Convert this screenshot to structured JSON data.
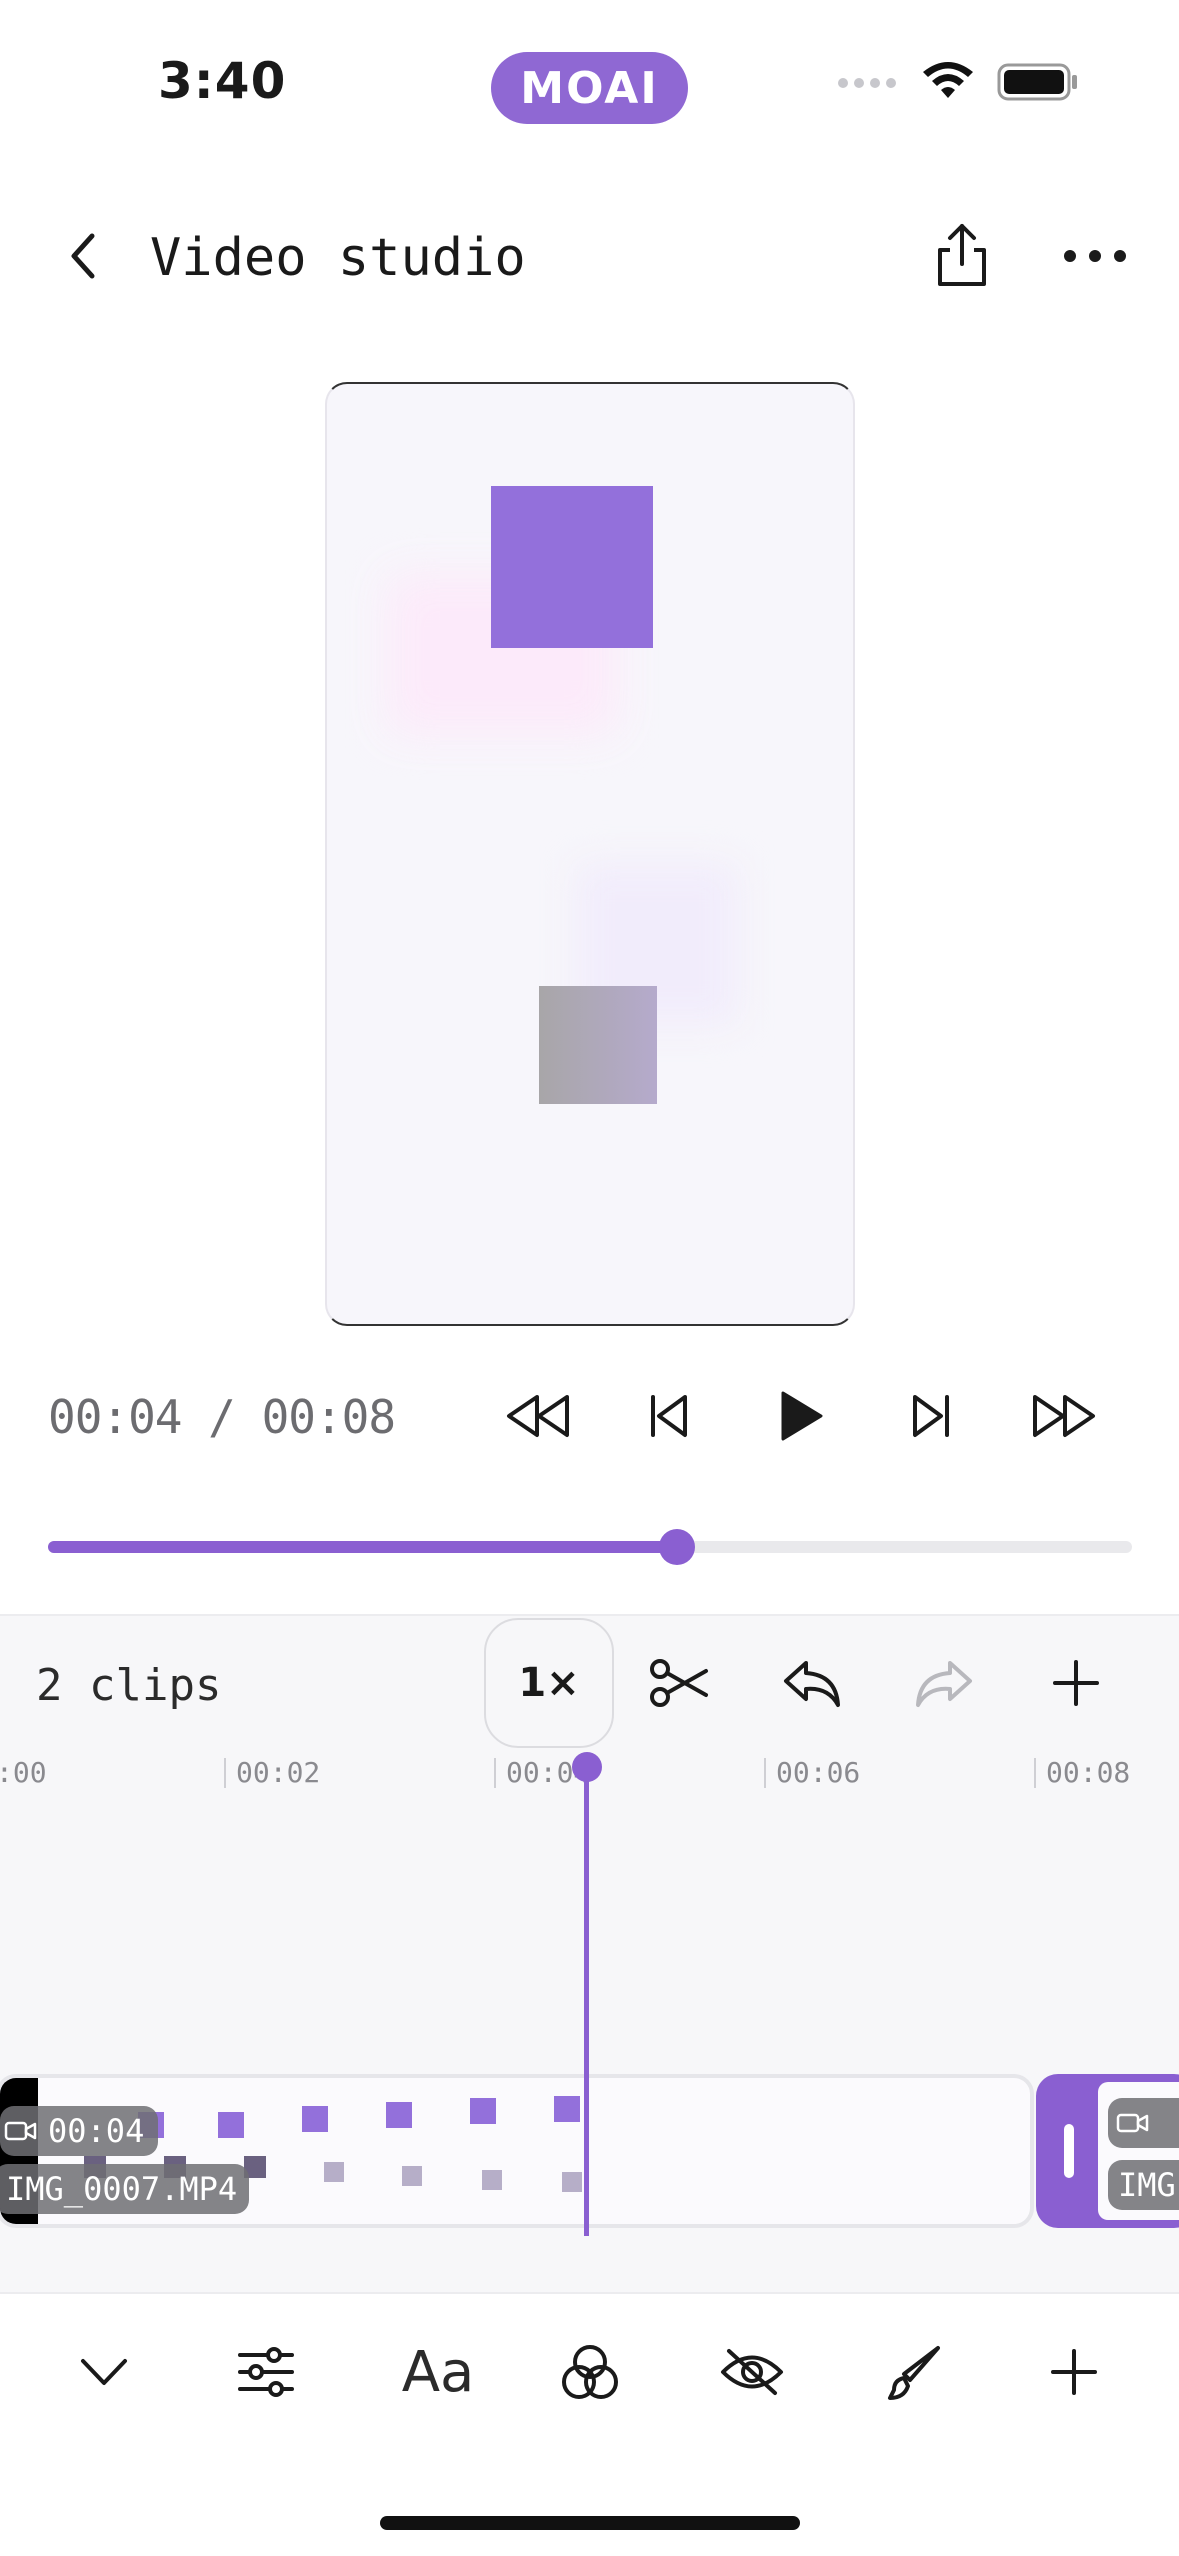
{
  "status_bar": {
    "time": "3:40",
    "app_pill": "MOAI"
  },
  "header": {
    "title": "Video studio",
    "icons": [
      "chevron-left-icon",
      "share-icon",
      "more-horizontal-icon"
    ]
  },
  "player": {
    "current_time": "00:04",
    "separator": " / ",
    "duration": "00:08",
    "progress": 0.58,
    "controls": [
      "rewind-icon",
      "skip-back-icon",
      "play-icon",
      "skip-forward-icon",
      "fast-forward-icon"
    ]
  },
  "timeline": {
    "clips_label": "2 clips",
    "speed_label": "1×",
    "tools": [
      "scissors-icon",
      "undo-icon",
      "redo-icon",
      "plus-icon"
    ],
    "ruler": [
      ":00",
      "00:02",
      "00:04",
      "00:06",
      "00:08"
    ],
    "clip1": {
      "duration": "00:04",
      "name": "IMG_0007.MP4"
    },
    "clip2": {
      "name": "IMG"
    }
  },
  "bottom_toolbar": {
    "items": [
      "chevron-down-icon",
      "sliders-icon",
      "text-icon",
      "color-filter-icon",
      "eye-off-icon",
      "brush-icon",
      "plus-icon"
    ],
    "text_label": "Aa"
  },
  "colors": {
    "accent": "#8a5fd1",
    "preview_purple": "#9370db"
  }
}
